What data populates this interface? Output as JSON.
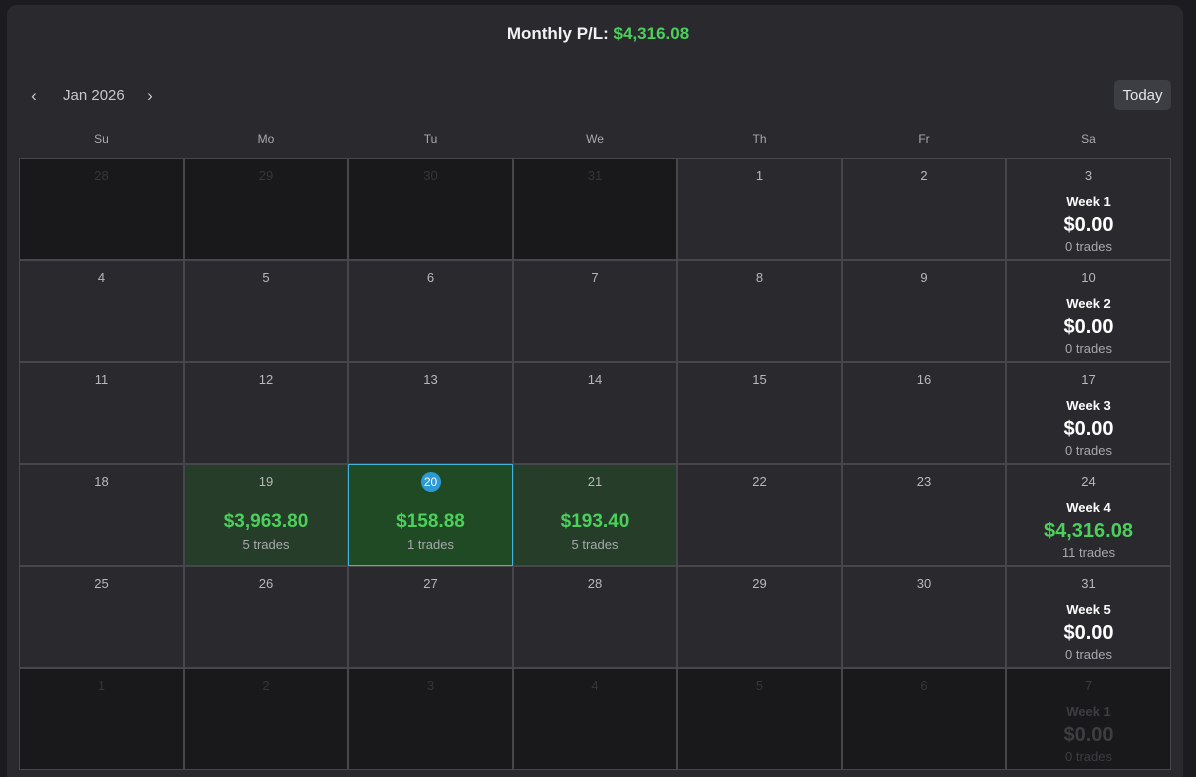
{
  "header": {
    "monthly_label": "Monthly P/L:",
    "monthly_value": "$4,316.08"
  },
  "nav": {
    "prev_icon": "‹",
    "next_icon": "›",
    "month": "Jan 2026",
    "today_label": "Today"
  },
  "weekdays": [
    "Su",
    "Mo",
    "Tu",
    "We",
    "Th",
    "Fr",
    "Sa"
  ],
  "weeks": [
    {
      "days": [
        {
          "day": "28",
          "outside": true
        },
        {
          "day": "29",
          "outside": true
        },
        {
          "day": "30",
          "outside": true
        },
        {
          "day": "31",
          "outside": true
        },
        {
          "day": "1"
        },
        {
          "day": "2"
        },
        {
          "day": "3"
        }
      ],
      "summary": {
        "label": "Week 1",
        "amount": "$0.00",
        "trades": "0 trades"
      }
    },
    {
      "days": [
        {
          "day": "4"
        },
        {
          "day": "5"
        },
        {
          "day": "6"
        },
        {
          "day": "7"
        },
        {
          "day": "8"
        },
        {
          "day": "9"
        },
        {
          "day": "10"
        }
      ],
      "summary": {
        "label": "Week 2",
        "amount": "$0.00",
        "trades": "0 trades"
      }
    },
    {
      "days": [
        {
          "day": "11"
        },
        {
          "day": "12"
        },
        {
          "day": "13"
        },
        {
          "day": "14"
        },
        {
          "day": "15"
        },
        {
          "day": "16"
        },
        {
          "day": "17"
        }
      ],
      "summary": {
        "label": "Week 3",
        "amount": "$0.00",
        "trades": "0 trades"
      }
    },
    {
      "days": [
        {
          "day": "18"
        },
        {
          "day": "19",
          "pl": "$3,963.80",
          "trades": "5 trades"
        },
        {
          "day": "20",
          "pl": "$158.88",
          "trades": "1 trades",
          "today": true
        },
        {
          "day": "21",
          "pl": "$193.40",
          "trades": "5 trades"
        },
        {
          "day": "22"
        },
        {
          "day": "23"
        },
        {
          "day": "24"
        }
      ],
      "summary": {
        "label": "Week 4",
        "amount": "$4,316.08",
        "trades": "11 trades",
        "positive": true
      }
    },
    {
      "days": [
        {
          "day": "25"
        },
        {
          "day": "26"
        },
        {
          "day": "27"
        },
        {
          "day": "28"
        },
        {
          "day": "29"
        },
        {
          "day": "30"
        },
        {
          "day": "31"
        }
      ],
      "summary": {
        "label": "Week 5",
        "amount": "$0.00",
        "trades": "0 trades"
      }
    },
    {
      "days": [
        {
          "day": "1",
          "outside": true
        },
        {
          "day": "2",
          "outside": true
        },
        {
          "day": "3",
          "outside": true
        },
        {
          "day": "4",
          "outside": true
        },
        {
          "day": "5",
          "outside": true
        },
        {
          "day": "6",
          "outside": true
        },
        {
          "day": "7",
          "outside": true
        }
      ],
      "summary": {
        "label": "Week 1",
        "amount": "$0.00",
        "trades": "0 trades"
      }
    }
  ],
  "colors": {
    "profit": "#4cd05c",
    "today_badge": "#2d9ad8",
    "selected_border": "#3fb3d9"
  }
}
